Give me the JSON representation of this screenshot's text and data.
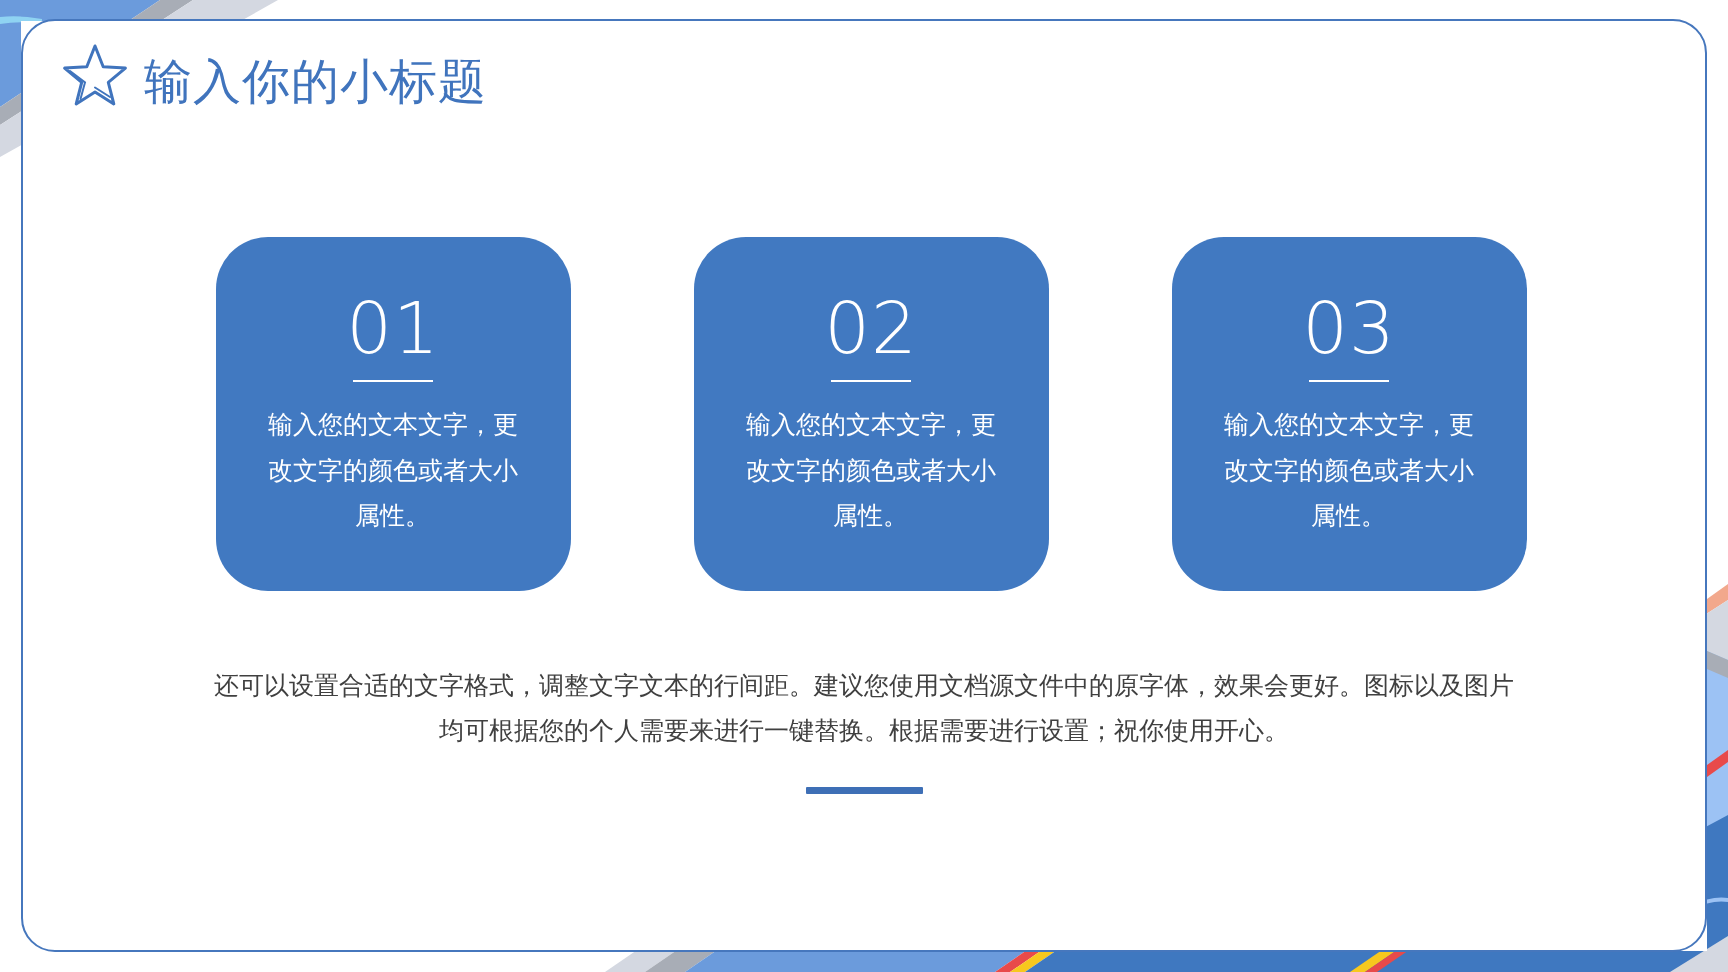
{
  "slide": {
    "title": "输入你的小标题"
  },
  "cards": [
    {
      "number": "01",
      "text": "输入您的文本文字，更改文字的颜色或者大小属性。"
    },
    {
      "number": "02",
      "text": "输入您的文本文字，更改文字的颜色或者大小属性。"
    },
    {
      "number": "03",
      "text": "输入您的文本文字，更改文字的颜色或者大小属性。"
    }
  ],
  "paragraph": "还可以设置合适的文字格式，调整文字文本的行间距。建议您使用文档源文件中的原字体，效果会更好。图标以及图片均可根据您的个人需要来进行一键替换。根据需要进行设置；祝你使用开心。"
}
